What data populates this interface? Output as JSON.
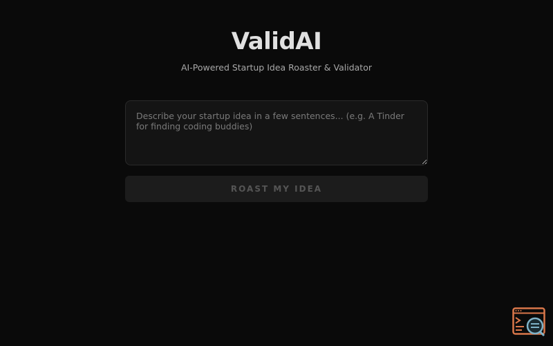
{
  "app": {
    "title": "ValidAI",
    "subtitle": "AI-Powered Startup Idea Roaster & Validator"
  },
  "form": {
    "idea_placeholder": "Describe your startup idea in a few sentences... (e.g. A Tinder for finding coding buddies)",
    "idea_value": "",
    "submit_label": "ROAST MY IDEA"
  },
  "colors": {
    "background": "#0a0a0a",
    "title": "#e0e0e0",
    "widget_accent": "#d9774a",
    "widget_lens": "#7fb2c7"
  },
  "icons": {
    "devtools_widget": "browser-search-icon"
  }
}
